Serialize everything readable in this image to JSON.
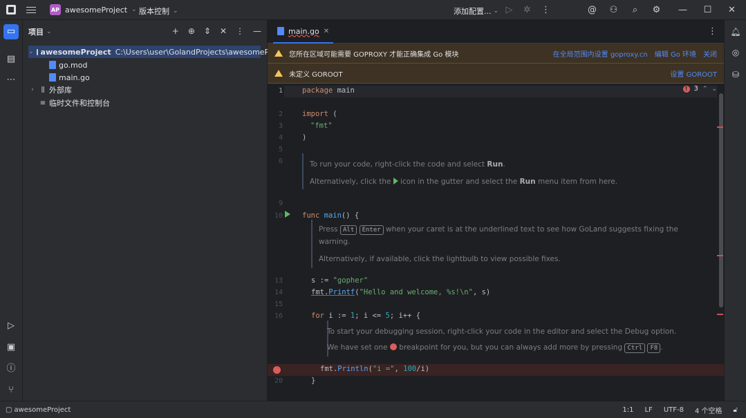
{
  "titlebar": {
    "project_badge": "AP",
    "project_name": "awesomeProject",
    "vcs_label": "版本控制",
    "run_config_label": "添加配置..."
  },
  "project_panel": {
    "title": "项目",
    "tree": [
      {
        "name": "awesomeProject",
        "path": "C:\\Users\\user\\GolandProjects\\awesomeProject"
      },
      {
        "name": "go.mod"
      },
      {
        "name": "main.go"
      },
      {
        "name": "外部库"
      },
      {
        "name": "临时文件和控制台"
      }
    ]
  },
  "editor": {
    "tab_label": "main.go",
    "banner1": {
      "text": "您所在区域可能需要 GOPROXY 才能正确集成 Go 模块",
      "links": [
        "在全局范围内设置 goproxy.cn",
        "编辑 Go 环境",
        "关闭"
      ]
    },
    "banner2": {
      "text": "未定义 GOROOT",
      "links": [
        "设置 GOROOT"
      ]
    },
    "error_count": "3",
    "line_numbers": [
      "1",
      "2",
      "3",
      "4",
      "5",
      "6",
      "9",
      "10",
      "13",
      "14",
      "15",
      "16",
      "20"
    ],
    "code": {
      "l1_kw": "package",
      "l1_name": " main",
      "l3_kw": "import",
      "l3_rest": " (",
      "l4_str": "\"fmt\"",
      "l5": ")",
      "l10_kw": "func",
      "l10_fn": " main",
      "l10_rest": "() {",
      "l13_a": "s := ",
      "l13_str": "\"gopher\"",
      "l14_pkg": "fmt.",
      "l14_fn": "Printf",
      "l14_paren": "(",
      "l14_str": "\"Hello and welcome, %s!\\n\"",
      "l14_rest": ", s)",
      "l16_kw": "for",
      "l16_a": " i := ",
      "l16_n1": "1",
      "l16_b": "; i <= ",
      "l16_n2": "5",
      "l16_c": "; i++ {",
      "l18_pkg": "fmt.",
      "l18_fn": "Println",
      "l18_a": "(",
      "l18_str": "\"i =\"",
      "l18_b": ", ",
      "l18_n": "100",
      "l18_c": "/i)",
      "l19": "}"
    },
    "docs": {
      "d1_a": "To run your code, right-click the code and select ",
      "d1_b": "Run",
      "d1_c": ".",
      "d2_a": "Alternatively, click the ",
      "d2_b": " icon in the gutter and select the ",
      "d2_c": "Run",
      "d2_d": " menu item from here.",
      "d3_a": "Press ",
      "d3_k1": "Alt",
      "d3_k2": "Enter",
      "d3_b": " when your caret is at the underlined text to see how GoLand suggests fixing the",
      "d3_c": "warning.",
      "d4": "Alternatively, if available, click the lightbulb to view possible fixes.",
      "d5": "To start your debugging session, right-click your code in the editor and select the Debug option.",
      "d6_a": "We have set one ",
      "d6_b": " breakpoint for you, but you can always add more by pressing ",
      "d6_k": "Ctrl",
      "d6_k2": "F8",
      "d6_c": "."
    }
  },
  "statusbar": {
    "project": "awesomeProject",
    "position": "1:1",
    "line_sep": "LF",
    "encoding": "UTF-8",
    "indent": "4 个空格"
  }
}
